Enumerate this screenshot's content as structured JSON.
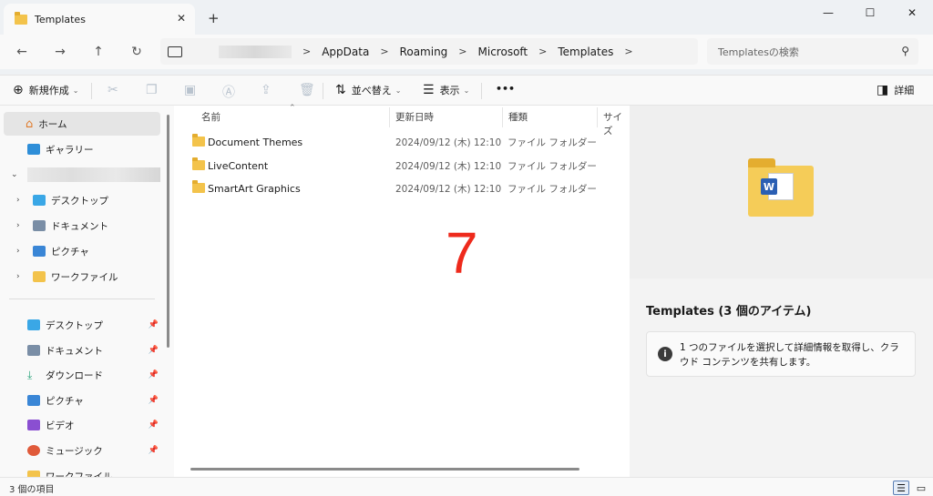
{
  "window": {
    "tab_title": "Templates",
    "new_tab": "+",
    "tab_close": "✕",
    "minimize": "—",
    "maximize": "☐",
    "close": "✕"
  },
  "nav": {
    "back": "←",
    "forward": "→",
    "up": "↑",
    "refresh": "↻"
  },
  "breadcrumb": [
    {
      "label": "AppData"
    },
    {
      "label": "Roaming"
    },
    {
      "label": "Microsoft"
    },
    {
      "label": "Templates"
    }
  ],
  "breadcrumb_sep": ">",
  "search": {
    "placeholder": "Templatesの検索",
    "icon": "search-icon"
  },
  "commands": {
    "new_label": "新規作成",
    "sort_label": "並べ替え",
    "view_label": "表示",
    "more": "•••",
    "details_label": "詳細"
  },
  "sidebar": {
    "home": "ホーム",
    "gallery": "ギャラリー",
    "tree": [
      {
        "label": "デスクトップ",
        "color": "#3aa7e6"
      },
      {
        "label": "ドキュメント",
        "color": "#7a8ea6"
      },
      {
        "label": "ピクチャ",
        "color": "#3a86d6"
      },
      {
        "label": "ワークファイル",
        "color": "#f3c34b"
      }
    ],
    "quick": [
      {
        "label": "デスクトップ",
        "color": "#3aa7e6"
      },
      {
        "label": "ドキュメント",
        "color": "#7a8ea6"
      },
      {
        "label": "ダウンロード",
        "color": "#2aa37a"
      },
      {
        "label": "ピクチャ",
        "color": "#3a86d6"
      },
      {
        "label": "ビデオ",
        "color": "#8a4fd1"
      },
      {
        "label": "ミュージック",
        "color": "#e05a3a"
      },
      {
        "label": "ワークファイル",
        "color": "#f3c34b"
      }
    ]
  },
  "columns": {
    "name": "名前",
    "date": "更新日時",
    "type": "種類",
    "size": "サイズ"
  },
  "files": [
    {
      "name": "Document Themes",
      "date": "2024/09/12 (木) 12:10",
      "type": "ファイル フォルダー"
    },
    {
      "name": "LiveContent",
      "date": "2024/09/12 (木) 12:10",
      "type": "ファイル フォルダー"
    },
    {
      "name": "SmartArt Graphics",
      "date": "2024/09/12 (木) 12:10",
      "type": "ファイル フォルダー"
    }
  ],
  "annotation_number": "7",
  "details": {
    "title": "Templates (3 個のアイテム)",
    "info": "1 つのファイルを選択して詳細情報を取得し、クラウド コンテンツを共有します。",
    "word_letter": "W"
  },
  "status": {
    "count": "3 個の項目"
  }
}
